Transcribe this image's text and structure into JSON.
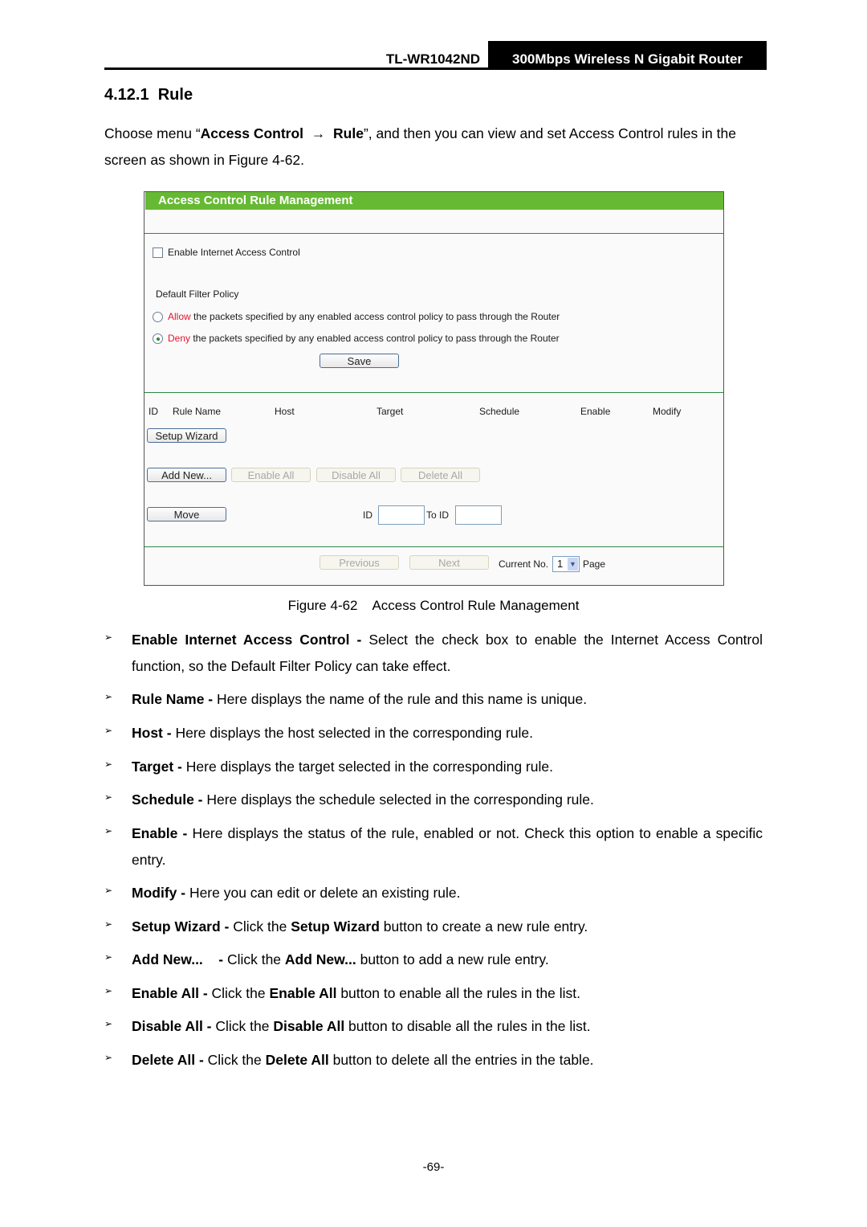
{
  "header": {
    "model": "TL-WR1042ND",
    "product": "300Mbps Wireless N Gigabit Router"
  },
  "section": {
    "number": "4.12.1",
    "title": "Rule"
  },
  "intro": {
    "prefix": "Choose menu “",
    "menu_path_1": "Access Control",
    "arrow": "→",
    "menu_path_2": "Rule",
    "suffix": "”, and then you can view and set Access Control rules in the screen as shown in Figure 4-62."
  },
  "figure": {
    "panel_title": "Access Control Rule Management",
    "enable_checkbox": {
      "label": "Enable Internet Access Control",
      "checked": false
    },
    "default_filter_policy": {
      "label": "Default Filter Policy",
      "options": [
        {
          "keyword": "Allow",
          "text": " the packets specified by any enabled access control policy to pass through the Router",
          "selected": false
        },
        {
          "keyword": "Deny",
          "text": " the packets specified by any enabled access control policy to pass through the Router",
          "selected": true
        }
      ]
    },
    "save_label": "Save",
    "table_columns": [
      "ID",
      "Rule Name",
      "Host",
      "Target",
      "Schedule",
      "Enable",
      "Modify"
    ],
    "buttons": {
      "setup_wizard": "Setup Wizard",
      "add_new": "Add New...",
      "enable_all": "Enable All",
      "disable_all": "Disable All",
      "delete_all": "Delete All",
      "move": "Move",
      "previous": "Previous",
      "next": "Next"
    },
    "move": {
      "id_label": "ID",
      "id_value": "",
      "to_id_label": "To ID",
      "to_id_value": ""
    },
    "pager": {
      "current_label": "Current No.",
      "current_value": "1",
      "page_label": "Page"
    },
    "colors": {
      "header_green": "#66b933",
      "divider_green": "#2c8a45",
      "policy_red": "#e8132e"
    }
  },
  "caption": "Figure 4-62    Access Control Rule Management",
  "bullets": [
    {
      "term": "Enable Internet Access Control - ",
      "text": "Select the check box to enable the Internet Access Control function, so the Default Filter Policy can take effect."
    },
    {
      "term": "Rule Name - ",
      "text": "Here displays the name of the rule and this name is unique."
    },
    {
      "term": "Host - ",
      "text": "Here displays the host selected in the corresponding rule."
    },
    {
      "term": "Target - ",
      "text": "Here displays the target selected in the corresponding rule."
    },
    {
      "term": "Schedule - ",
      "text": "Here displays the schedule selected in the corresponding rule."
    },
    {
      "term": "Enable - ",
      "text": "Here displays the status of the rule, enabled or not. Check this option to enable a specific entry."
    },
    {
      "term": "Modify - ",
      "text": "Here you can edit or delete an existing rule."
    },
    {
      "term": "Setup Wizard - ",
      "text_a": "Click the ",
      "bold": "Setup Wizard",
      "text_b": " button to create a new rule entry."
    },
    {
      "term": "Add New...    - ",
      "text_a": "Click the ",
      "bold": "Add New...",
      "text_b": " button to add a new rule entry."
    },
    {
      "term": "Enable All - ",
      "text_a": "Click the ",
      "bold": "Enable All",
      "text_b": " button to enable all the rules in the list."
    },
    {
      "term": "Disable All - ",
      "text_a": "Click the ",
      "bold": "Disable All",
      "text_b": " button to disable all the rules in the list."
    },
    {
      "term": "Delete All - ",
      "text_a": "Click the ",
      "bold": "Delete All",
      "text_b": " button to delete all the entries in the table."
    }
  ],
  "bullet_marker": "➢",
  "page_number": "-69-"
}
